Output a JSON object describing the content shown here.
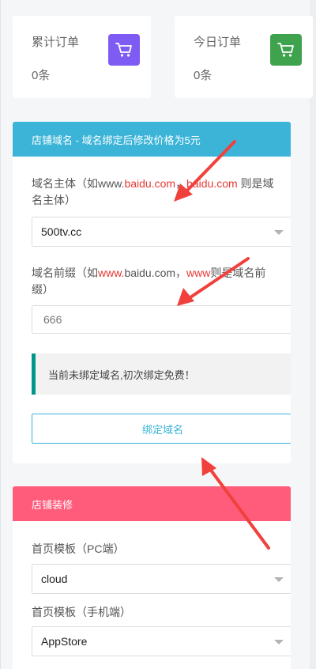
{
  "stats": [
    {
      "title": "累计订单",
      "value": "0条",
      "icon": "cart-icon",
      "color": "#7e5cf3"
    },
    {
      "title": "今日订单",
      "value": "0条",
      "icon": "cart-icon",
      "color": "#3fa34d"
    }
  ],
  "domain_panel": {
    "header": "店铺域名 - 域名绑定后修改价格为5元",
    "header_color": "#3bb4d8",
    "main_label_prefix": "域名主体（如www.",
    "main_label_red_1": "baidu.com",
    "main_label_mid": "，",
    "main_label_red_2": "baidu.com",
    "main_label_suffix": " 则是域名主体）",
    "main_value": "500tv.cc",
    "prefix_label_1": "域名前缀（如",
    "prefix_label_red": "www.",
    "prefix_label_2": "baidu.com，",
    "prefix_label_red_2": "www",
    "prefix_label_3": "则是域名前缀）",
    "prefix_placeholder": "666",
    "notice": "当前未绑定域名,初次绑定免费！",
    "bind_button": "绑定域名"
  },
  "decor_panel": {
    "header": "店铺装修",
    "header_color": "#ff5c7b",
    "pc_label": "首页模板（PC端）",
    "pc_value": "cloud",
    "mobile_label": "首页模板（手机端）",
    "mobile_value": "AppStore"
  },
  "annotation_color": "#f0413c"
}
